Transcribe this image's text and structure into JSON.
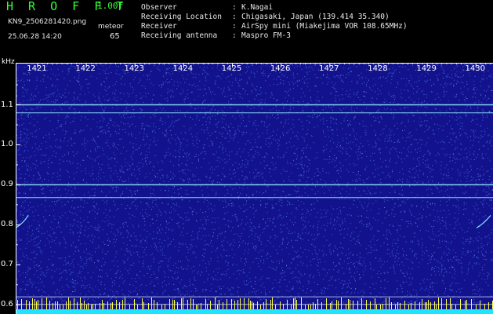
{
  "header": {
    "app_title": "H R O F F T",
    "version": "1.00f",
    "file_name": "KN9_2506281420.png",
    "meteor_label": "meteor",
    "datetime": "25.06.28 14:20",
    "meteor_count": "65"
  },
  "info": [
    {
      "key": "Observer",
      "value": "K.Nagai"
    },
    {
      "key": "Receiving Location",
      "value": "Chigasaki, Japan (139.414 35.340)"
    },
    {
      "key": "Receiver",
      "value": "AirSpy mini (Miakejima VOR 108.65MHz)"
    },
    {
      "key": "Receiving antenna",
      "value": "Maspro FM-3"
    }
  ],
  "separator": ":",
  "axis": {
    "unit": "kHz",
    "time_ticks": [
      "1421",
      "1422",
      "1423",
      "1424",
      "1425",
      "1426",
      "1427",
      "1428",
      "1429",
      "1430"
    ],
    "freq_ticks": [
      "1.1",
      "1.0",
      "0.9",
      "0.8",
      "0.7",
      "0.6"
    ],
    "freq_tick_values": [
      1.1,
      1.0,
      0.9,
      0.8,
      0.7,
      0.6
    ],
    "freq_range": [
      0.577,
      1.205
    ],
    "time_range": [
      1420.55,
      1430.35
    ]
  },
  "colors": {
    "background": "#000000",
    "spectrum_bg": "#12128c",
    "noise": "#3b57d6",
    "carrier": "#8fe8ff",
    "meteor_bar": "#ffff44",
    "baseline": "#1ee4ff",
    "axis": "#ffffff",
    "title": "#33ff33"
  },
  "carriers_khz": [
    1.1,
    1.08,
    0.9,
    0.868
  ],
  "reference_lines_khz": [
    0.62,
    0.601
  ]
}
